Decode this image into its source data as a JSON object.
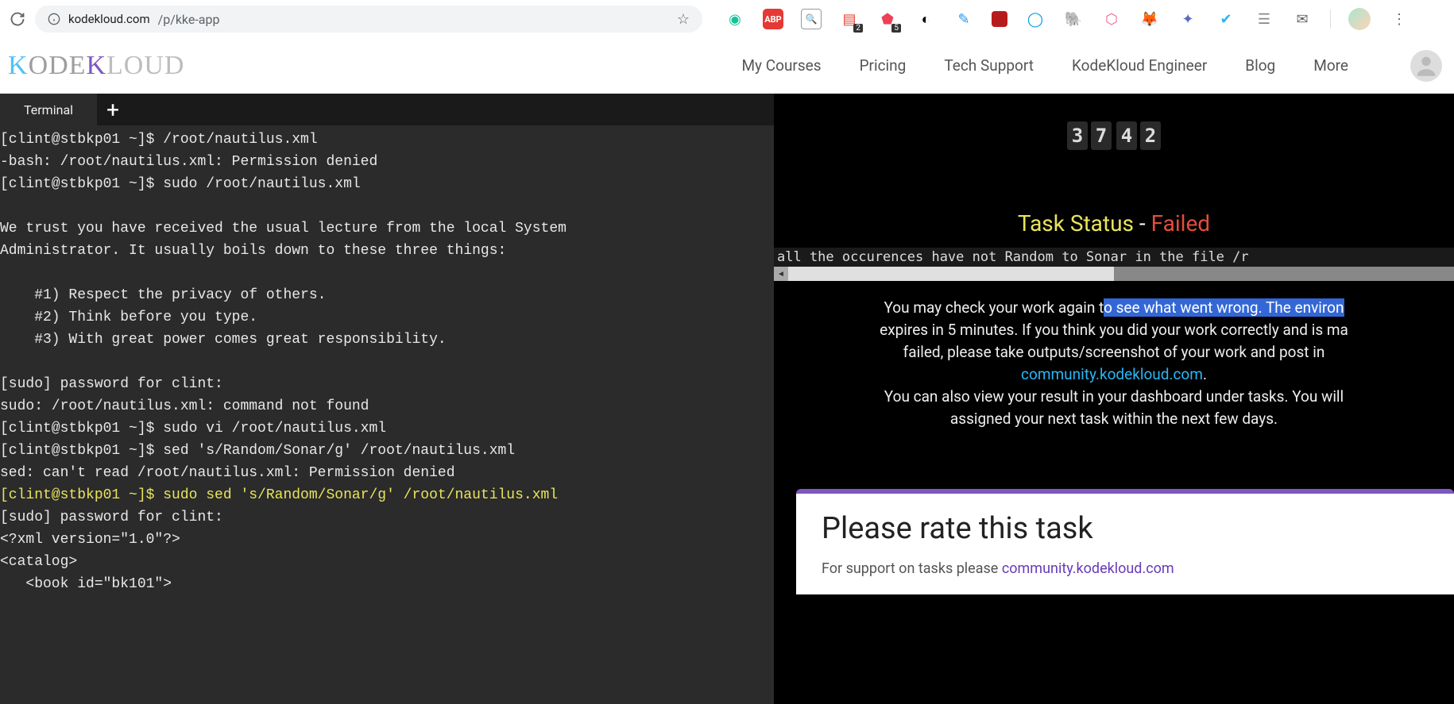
{
  "browser": {
    "url_host": "kodekloud.com",
    "url_path": "/p/kke-app"
  },
  "ext_badges": {
    "todoist": "2",
    "pocket": "5"
  },
  "nav": {
    "items": [
      "My Courses",
      "Pricing",
      "Tech Support",
      "KodeKloud Engineer",
      "Blog",
      "More"
    ]
  },
  "terminal": {
    "tab_label": "Terminal",
    "lines": [
      {
        "t": "[clint@stbkp01 ~]$ /root/nautilus.xml"
      },
      {
        "t": "-bash: /root/nautilus.xml: Permission denied"
      },
      {
        "t": "[clint@stbkp01 ~]$ sudo /root/nautilus.xml"
      },
      {
        "t": ""
      },
      {
        "t": "We trust you have received the usual lecture from the local System"
      },
      {
        "t": "Administrator. It usually boils down to these three things:"
      },
      {
        "t": ""
      },
      {
        "t": "    #1) Respect the privacy of others."
      },
      {
        "t": "    #2) Think before you type."
      },
      {
        "t": "    #3) With great power comes great responsibility."
      },
      {
        "t": ""
      },
      {
        "t": "[sudo] password for clint:"
      },
      {
        "t": "sudo: /root/nautilus.xml: command not found"
      },
      {
        "t": "[clint@stbkp01 ~]$ sudo vi /root/nautilus.xml"
      },
      {
        "t": "[clint@stbkp01 ~]$ sed 's/Random/Sonar/g' /root/nautilus.xml"
      },
      {
        "t": "sed: can't read /root/nautilus.xml: Permission denied"
      },
      {
        "t": "[clint@stbkp01 ~]$ sudo sed 's/Random/Sonar/g' /root/nautilus.xml",
        "hl": true
      },
      {
        "t": "[sudo] password for clint:"
      },
      {
        "t": "<?xml version=\"1.0\"?>"
      },
      {
        "t": "<catalog>"
      },
      {
        "t": "   <book id=\"bk101\">"
      }
    ]
  },
  "status": {
    "timer": [
      "3",
      "7",
      "4",
      "2"
    ],
    "label": "Task Status",
    "sep": " - ",
    "value": "Failed",
    "error_msg": "all the occurences have not Random to Sonar in the file /r",
    "info_pre": "You may check your work again t",
    "info_sel": "o see what went wrong. The environ",
    "info_rest1": "expires in 5 minutes. If you think you did your work correctly and is ma",
    "info_rest2": "failed, please take outputs/screenshot of your work and post in",
    "community_link": "community.kodekloud.com",
    "info_rest3": "You can also view your result in your dashboard under tasks. You will",
    "info_rest4": "assigned your next task within the next few days."
  },
  "rate": {
    "title": "Please rate this task",
    "sub_pre": "For support on tasks please ",
    "sub_link": "community.kodekloud.com"
  }
}
